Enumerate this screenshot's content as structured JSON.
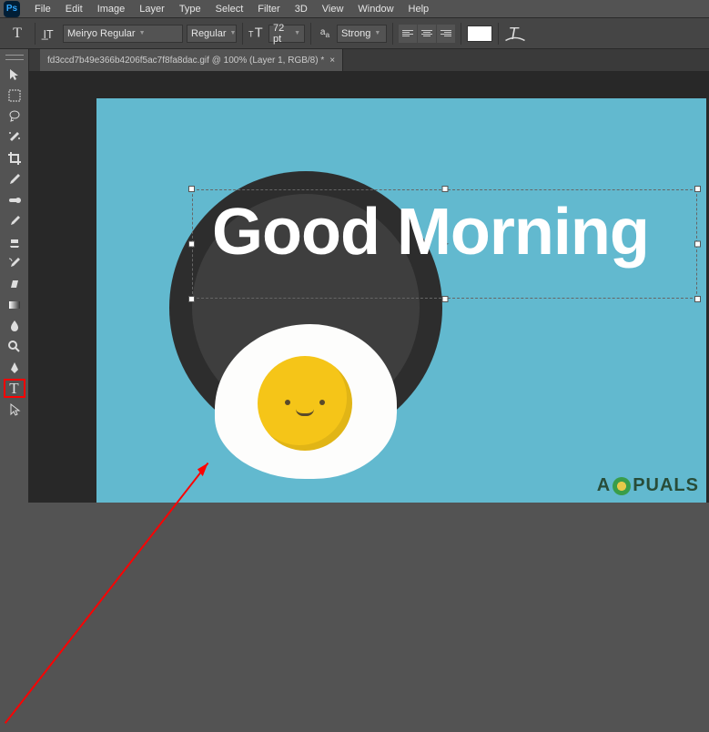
{
  "app": {
    "logo_text": "Ps"
  },
  "menu": [
    "File",
    "Edit",
    "Image",
    "Layer",
    "Type",
    "Select",
    "Filter",
    "3D",
    "View",
    "Window",
    "Help"
  ],
  "optionsbar": {
    "font_family": "Meiryo Regular",
    "font_style": "Regular",
    "font_size": "72 pt",
    "antialias": "Strong"
  },
  "tools": [
    {
      "name": "move-tool"
    },
    {
      "name": "marquee-tool"
    },
    {
      "name": "lasso-tool"
    },
    {
      "name": "magic-wand-tool"
    },
    {
      "name": "crop-tool"
    },
    {
      "name": "eyedropper-tool"
    },
    {
      "name": "spot-healing-tool"
    },
    {
      "name": "brush-tool"
    },
    {
      "name": "clone-stamp-tool"
    },
    {
      "name": "history-brush-tool"
    },
    {
      "name": "eraser-tool"
    },
    {
      "name": "gradient-tool"
    },
    {
      "name": "blur-tool"
    },
    {
      "name": "dodge-tool"
    },
    {
      "name": "pen-tool"
    },
    {
      "name": "type-tool",
      "highlighted": true
    },
    {
      "name": "path-selection-tool"
    }
  ],
  "tab": {
    "title": "fd3ccd7b49e366b4206f5ac7f8fa8dac.gif @ 100% (Layer 1, RGB/8) *"
  },
  "canvas": {
    "text": "Good Morning"
  },
  "watermark": {
    "text_left": "A",
    "text_right": "PUALS"
  }
}
